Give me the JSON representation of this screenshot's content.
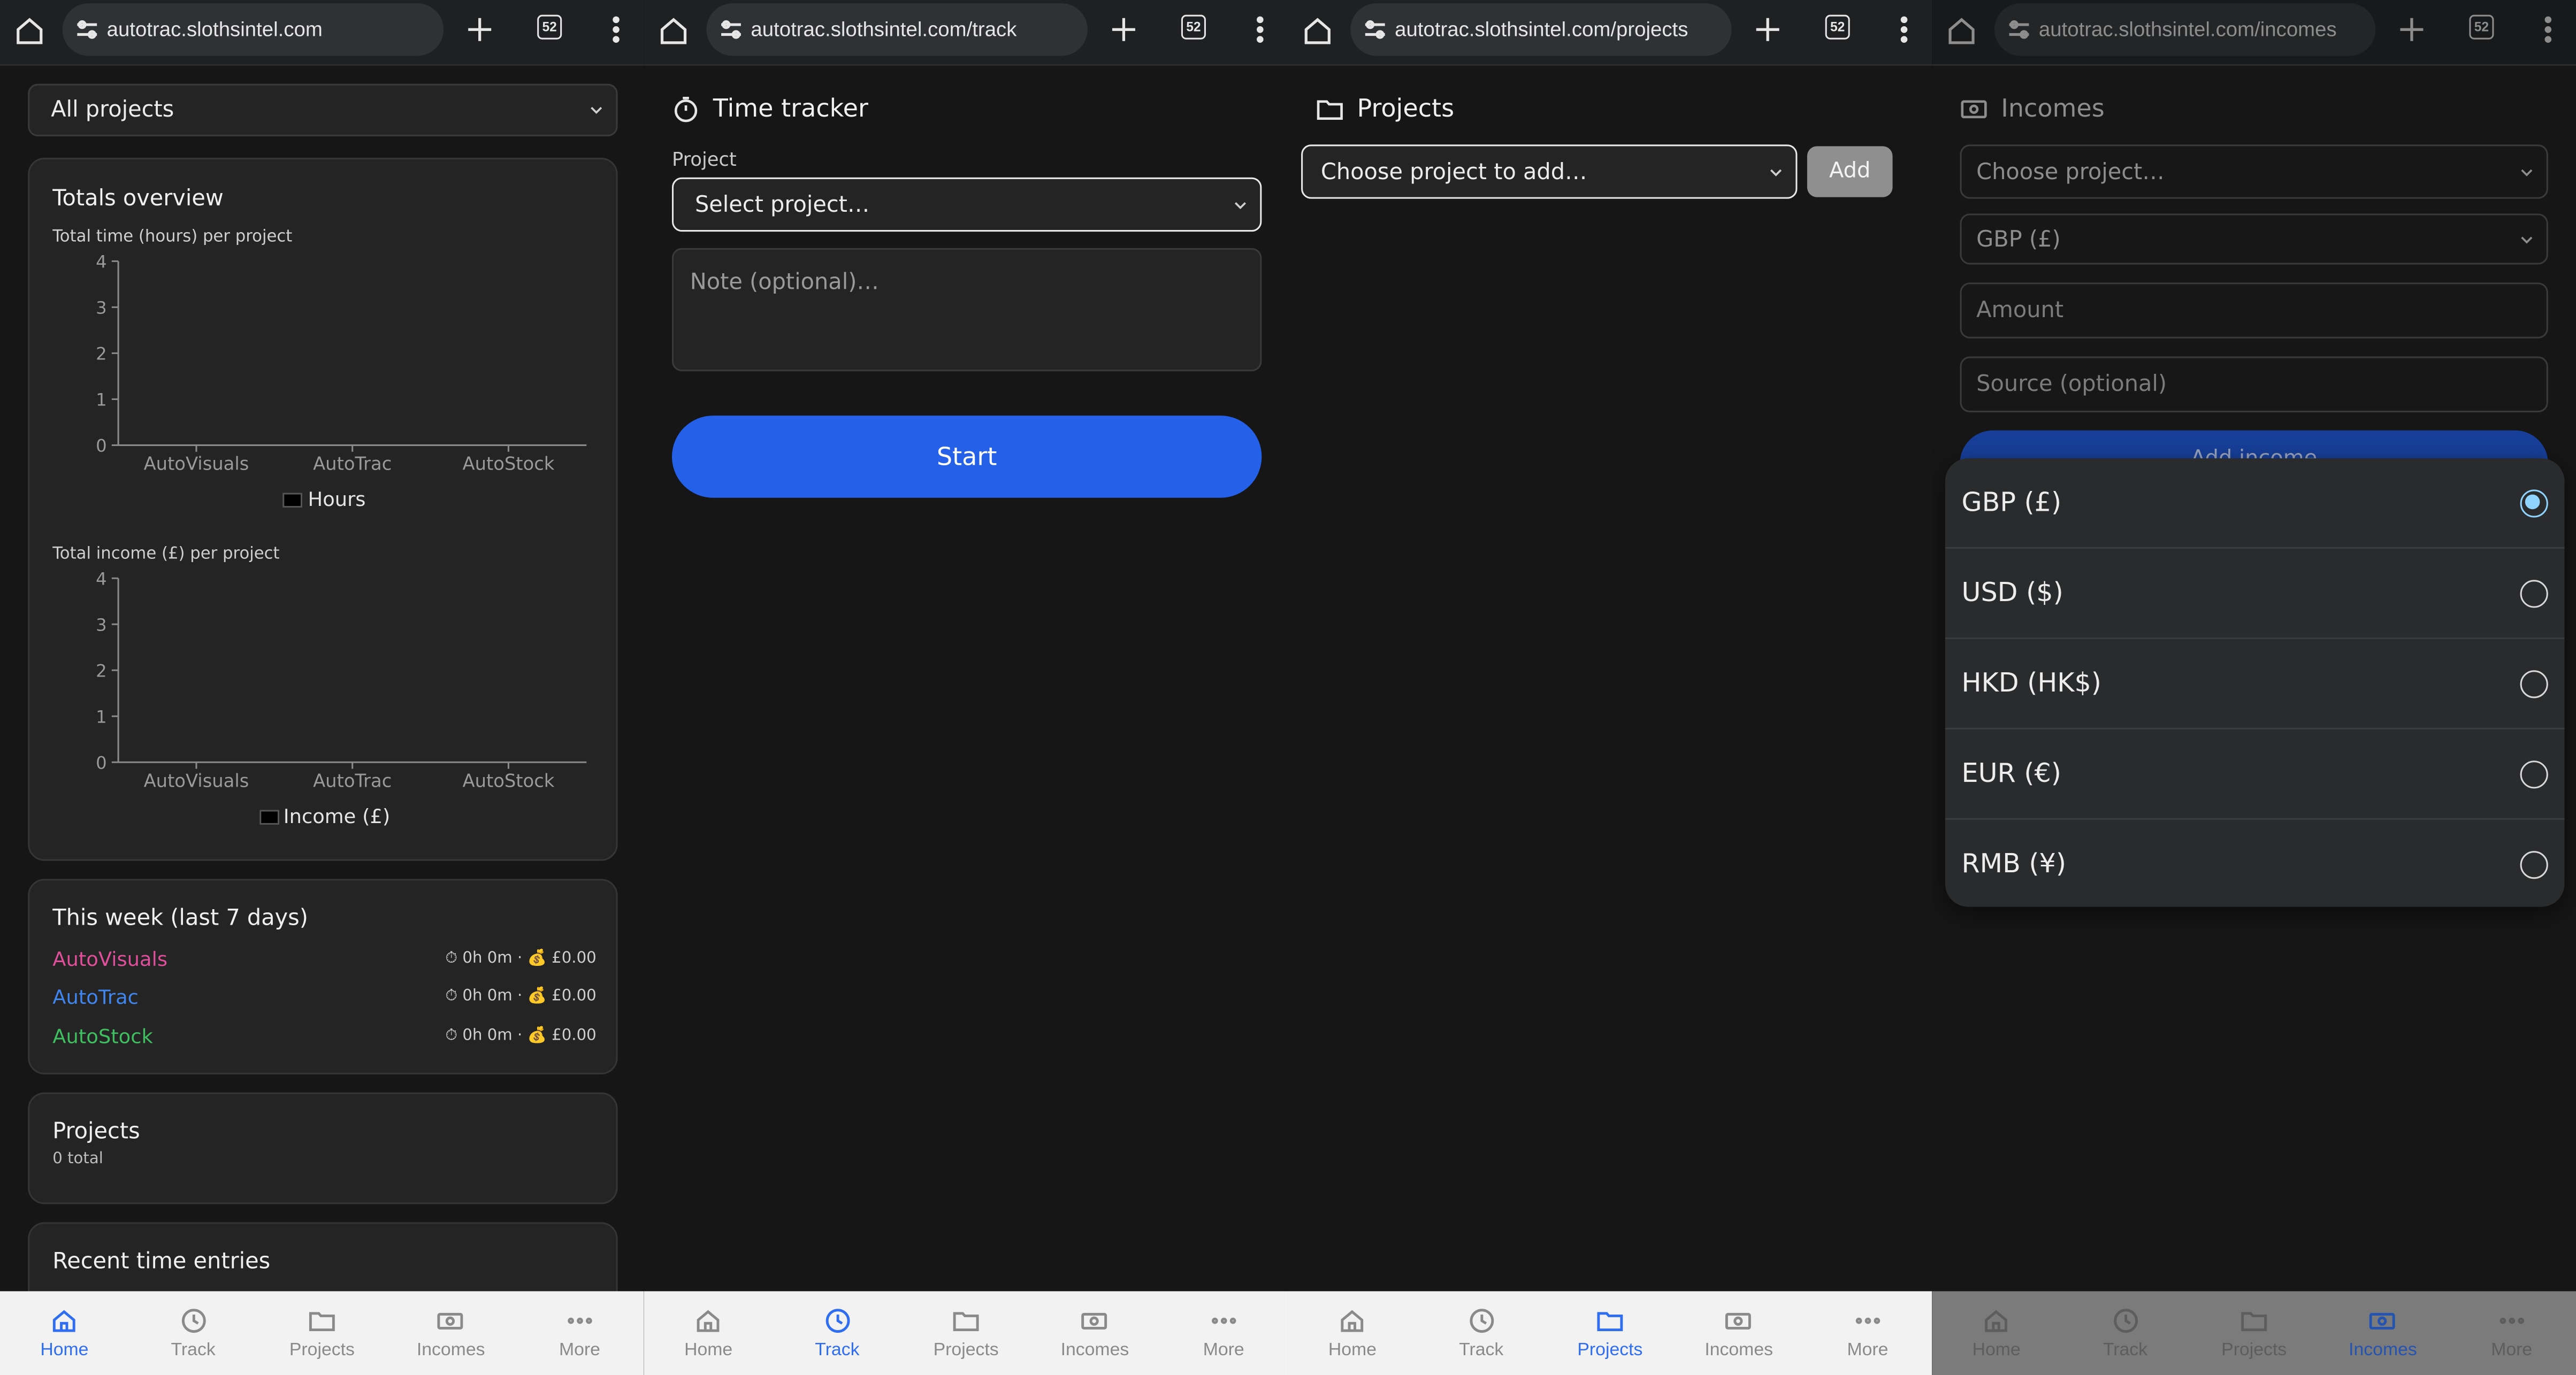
{
  "browser": {
    "tab_count": "52",
    "urls": [
      "autotrac.slothsintel.com",
      "autotrac.slothsintel.com/track",
      "autotrac.slothsintel.com/projects",
      "autotrac.slothsintel.com/incomes"
    ]
  },
  "nav": {
    "items": [
      "Home",
      "Track",
      "Projects",
      "Incomes",
      "More"
    ],
    "active_per_panel": [
      "Home",
      "Track",
      "Projects",
      "Incomes"
    ],
    "active_color": "#2f6ef0"
  },
  "home": {
    "project_filter": "All projects",
    "totals": {
      "title": "Totals overview",
      "hours_caption": "Total time (hours) per project",
      "income_caption": "Total income (£) per project"
    },
    "week": {
      "title": "This week (last 7 days)",
      "rows": [
        {
          "name": "AutoVisuals",
          "color": "#e0509a",
          "time": "⏱ 0h 0m",
          "income": "💰 £0.00"
        },
        {
          "name": "AutoTrac",
          "color": "#3f86f0",
          "time": "⏱ 0h 0m",
          "income": "💰 £0.00"
        },
        {
          "name": "AutoStock",
          "color": "#3fbf5f",
          "time": "⏱ 0h 0m",
          "income": "💰 £0.00"
        }
      ]
    },
    "projects": {
      "title": "Projects",
      "count": "0 total"
    },
    "recent": {
      "title": "Recent time entries"
    }
  },
  "chart_data": [
    {
      "type": "bar",
      "categories": [
        "AutoVisuals",
        "AutoTrac",
        "AutoStock"
      ],
      "series": [
        {
          "name": "Hours",
          "values": [
            0,
            0,
            0
          ],
          "color": "#000000"
        }
      ],
      "ylim": [
        0,
        4
      ],
      "yticks": [
        "0",
        "1",
        "2",
        "3",
        "4"
      ],
      "grid": false,
      "legend": "bottom-center"
    },
    {
      "type": "bar",
      "categories": [
        "AutoVisuals",
        "AutoTrac",
        "AutoStock"
      ],
      "series": [
        {
          "name": "Income (£)",
          "values": [
            0,
            0,
            0
          ],
          "color": "#000000"
        }
      ],
      "ylim": [
        0,
        4
      ],
      "yticks": [
        "0",
        "1",
        "2",
        "3",
        "4"
      ],
      "grid": false,
      "legend": "bottom-center"
    }
  ],
  "track": {
    "title": "Time tracker",
    "project_label": "Project",
    "project_select": "Select project…",
    "note_placeholder": "Note (optional)…",
    "start_label": "Start",
    "accent": "#2461e8"
  },
  "projects_page": {
    "title": "Projects",
    "choose": "Choose project to add…",
    "add_label": "Add"
  },
  "incomes": {
    "title": "Incomes",
    "project_select": "Choose project…",
    "currency_select": "GBP (£)",
    "amount_placeholder": "Amount",
    "source_placeholder": "Source (optional)",
    "add_label": "Add income",
    "currency_options": [
      {
        "label": "GBP (£)",
        "selected": true
      },
      {
        "label": "USD ($)",
        "selected": false
      },
      {
        "label": "HKD (HK$)",
        "selected": false
      },
      {
        "label": "EUR (€)",
        "selected": false
      },
      {
        "label": "RMB (¥)",
        "selected": false
      }
    ],
    "radio_color": "#8fd3ff"
  }
}
